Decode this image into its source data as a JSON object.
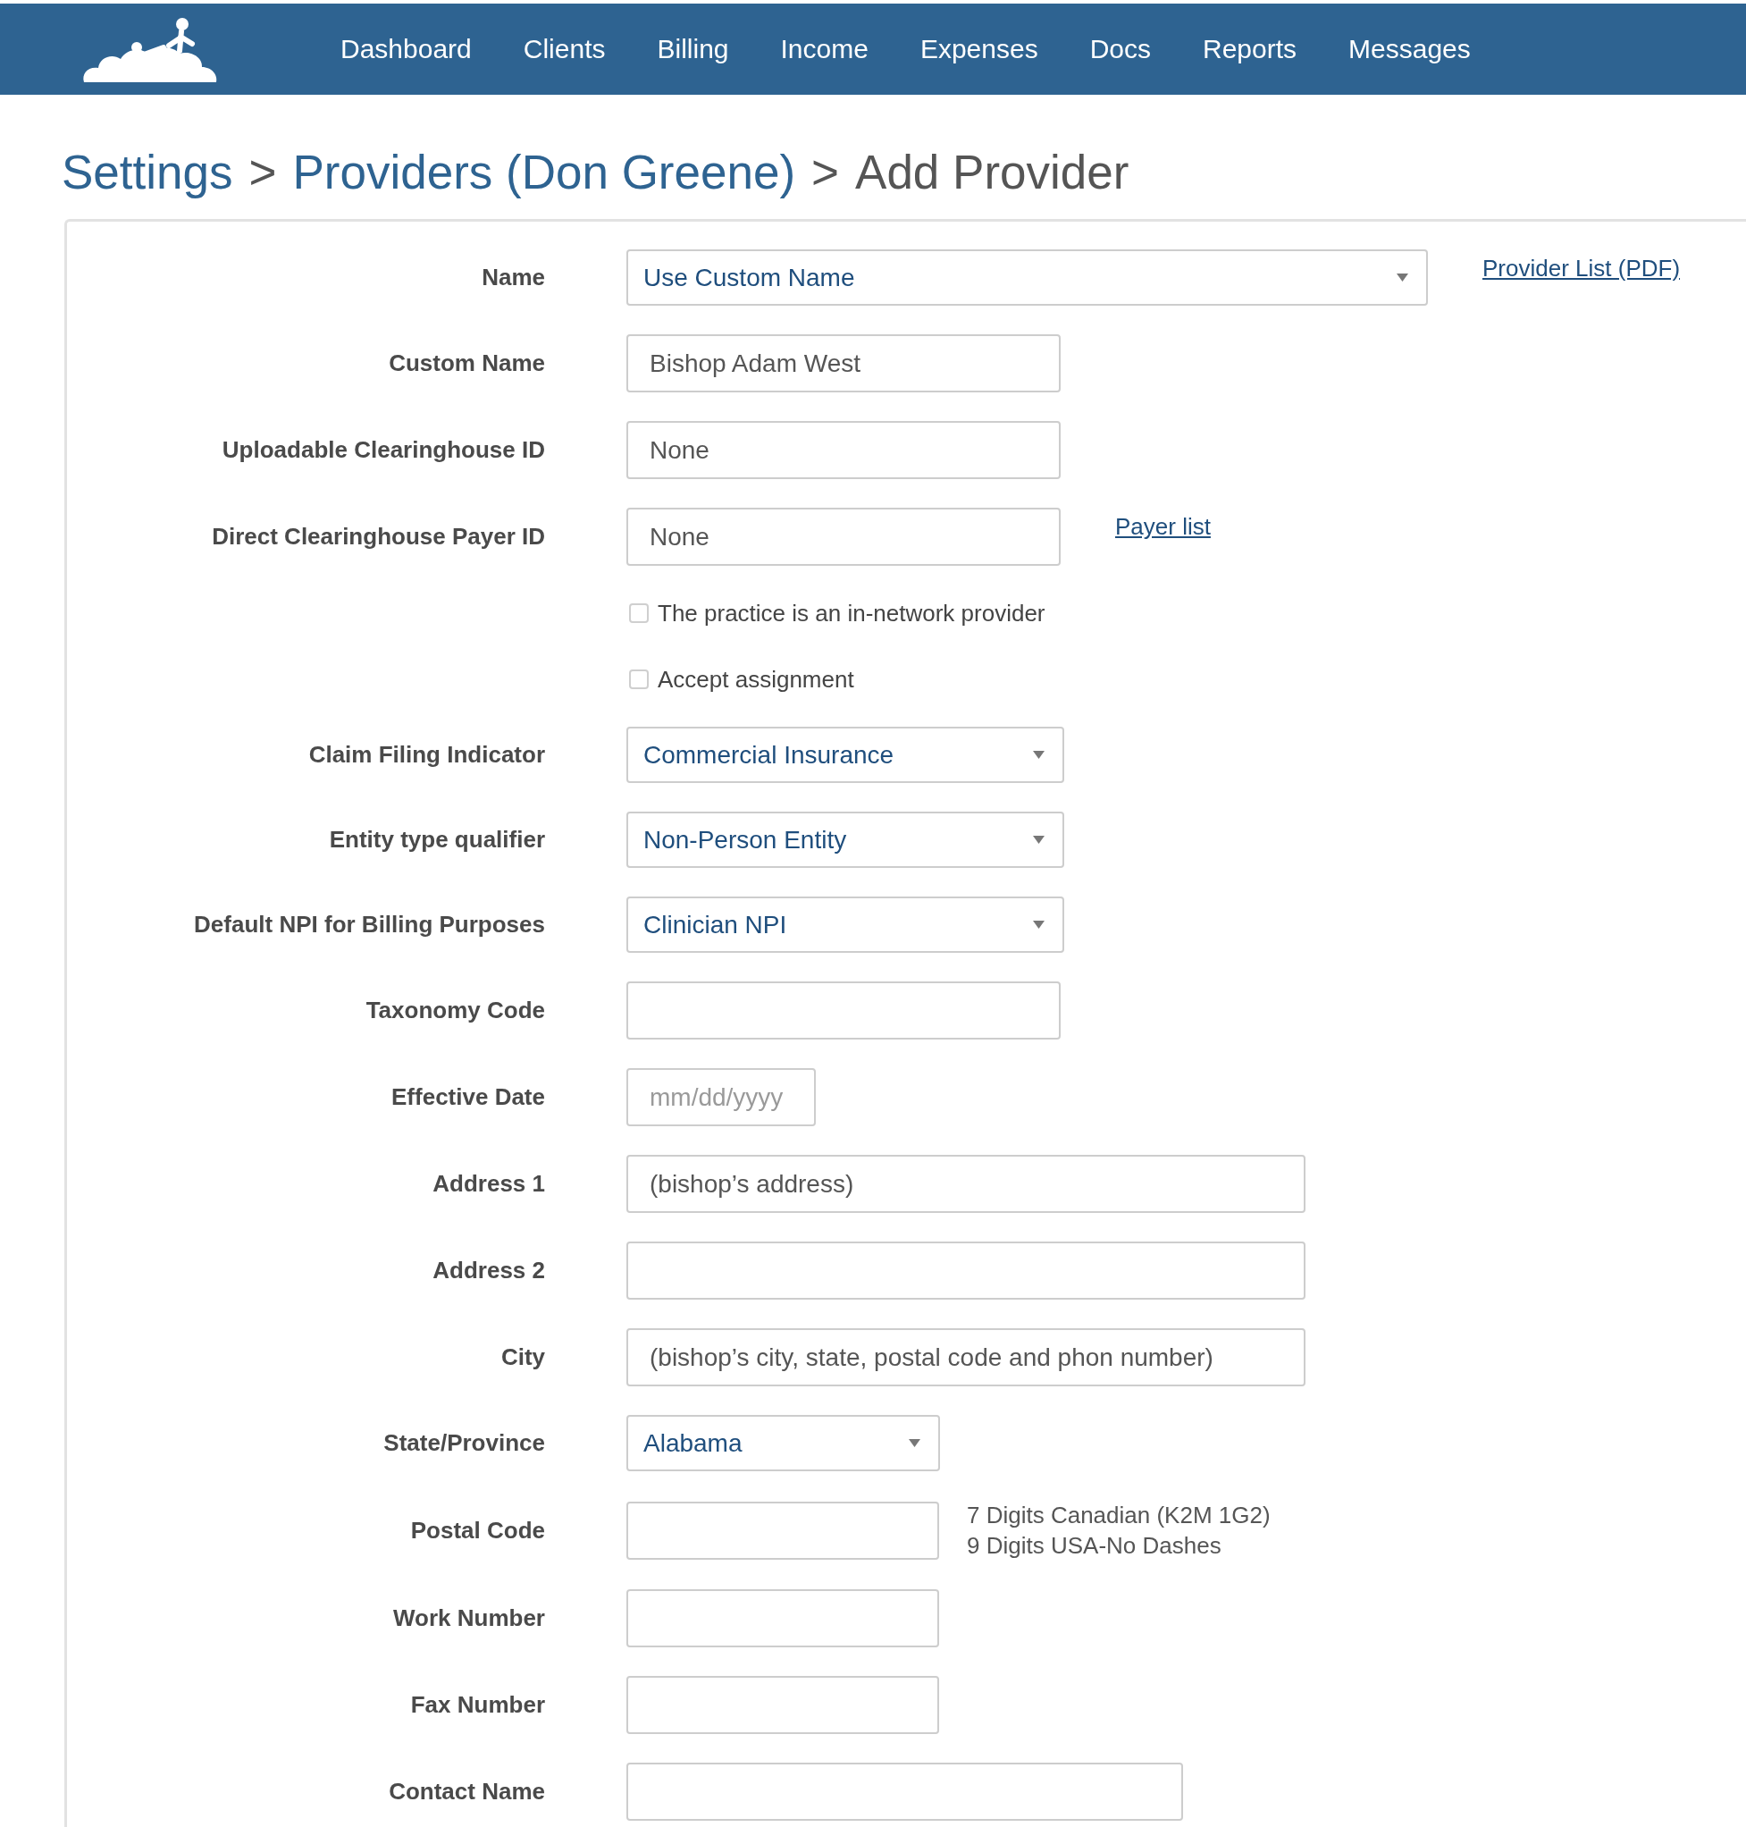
{
  "nav": {
    "items": [
      "Dashboard",
      "Clients",
      "Billing",
      "Income",
      "Expenses",
      "Docs",
      "Reports",
      "Messages"
    ]
  },
  "breadcrumb": [
    {
      "kind": "link",
      "label": "Settings"
    },
    {
      "kind": "separator",
      "label": ">"
    },
    {
      "kind": "link",
      "label": "Providers (Don Greene)"
    },
    {
      "kind": "separator",
      "label": ">"
    },
    {
      "kind": "current",
      "label": "Add Provider"
    }
  ],
  "form": {
    "rows": [
      {
        "kind": "select",
        "label": "Name",
        "value": "Use Custom Name",
        "link": "Provider List (PDF)"
      },
      {
        "kind": "input",
        "label": "Custom Name",
        "value": "Bishop Adam West"
      },
      {
        "kind": "input",
        "label": "Uploadable Clearinghouse ID",
        "value": "None"
      },
      {
        "kind": "input",
        "label": "Direct Clearinghouse Payer ID",
        "value": "None",
        "link": "Payer list"
      },
      {
        "kind": "checkbox",
        "label": "The practice is an in-network provider",
        "checked": false
      },
      {
        "kind": "checkbox",
        "label": "Accept assignment",
        "checked": false
      },
      {
        "kind": "select",
        "label": "Claim Filing Indicator",
        "value": "Commercial Insurance"
      },
      {
        "kind": "select",
        "label": "Entity type qualifier",
        "value": "Non-Person Entity"
      },
      {
        "kind": "select",
        "label": "Default NPI for Billing Purposes",
        "value": "Clinician NPI"
      },
      {
        "kind": "input",
        "label": "Taxonomy Code"
      },
      {
        "kind": "input",
        "label": "Effective Date",
        "placeholder": "mm/dd/yyyy"
      },
      {
        "kind": "input",
        "label": "Address 1",
        "value": "(bishop’s address)"
      },
      {
        "kind": "input",
        "label": "Address 2"
      },
      {
        "kind": "input",
        "label": "City",
        "value": "(bishop’s city, state, postal code and phon number)"
      },
      {
        "kind": "select",
        "label": "State/Province",
        "value": "Alabama"
      },
      {
        "kind": "input",
        "label": "Postal Code",
        "hint": [
          "7 Digits Canadian (K2M 1G2)",
          "9 Digits USA-No Dashes"
        ]
      },
      {
        "kind": "input",
        "label": "Work Number"
      },
      {
        "kind": "input",
        "label": "Fax Number"
      },
      {
        "kind": "input",
        "label": "Contact Name"
      }
    ]
  }
}
